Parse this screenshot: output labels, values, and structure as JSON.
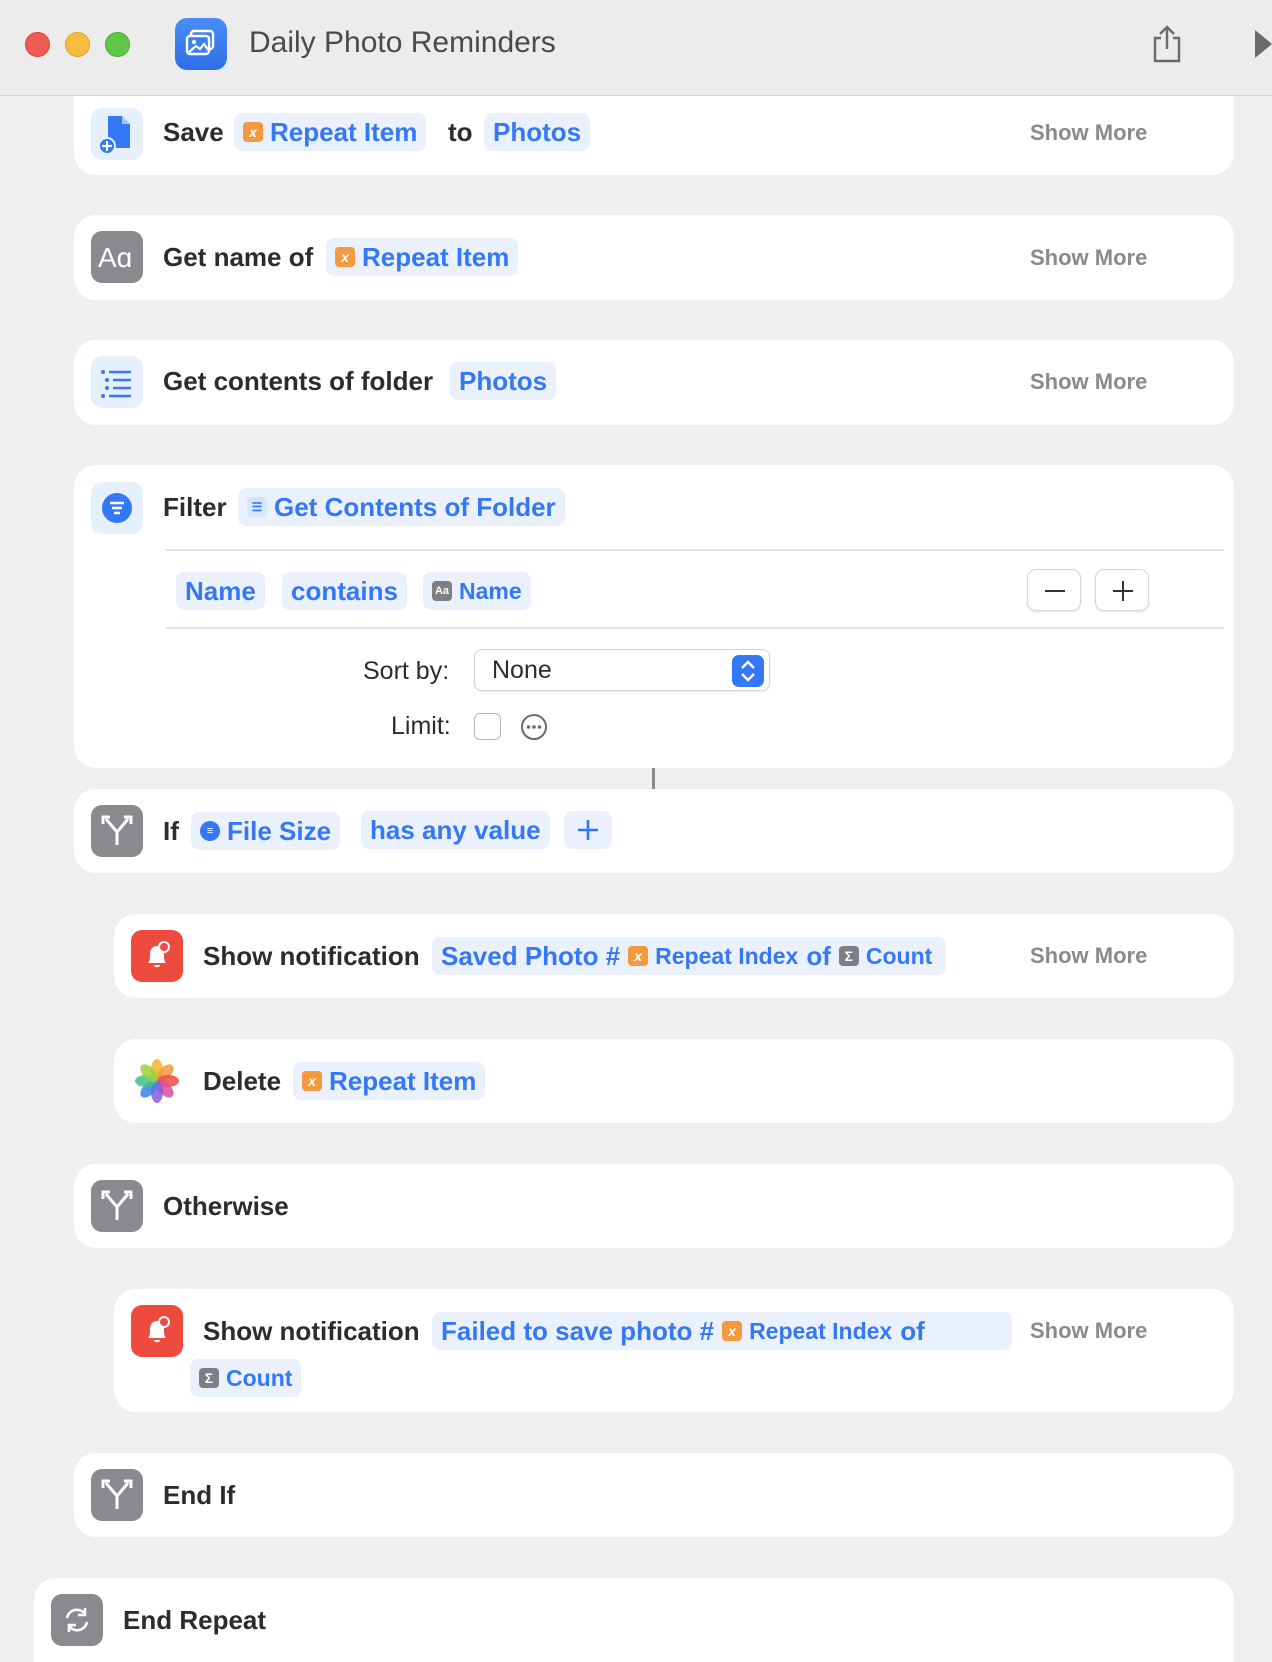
{
  "window": {
    "title": "Daily Photo Reminders"
  },
  "actions": {
    "save": {
      "verb": "Save",
      "item": "Repeat Item",
      "to": "to",
      "dest": "Photos",
      "show_more": "Show More"
    },
    "get_name": {
      "verb": "Get name of",
      "item": "Repeat Item",
      "show_more": "Show More"
    },
    "get_contents": {
      "verb": "Get contents of folder",
      "folder": "Photos",
      "show_more": "Show More"
    },
    "filter": {
      "verb": "Filter",
      "source": "Get Contents of Folder",
      "condition": {
        "field": "Name",
        "operator": "contains",
        "value": "Name"
      },
      "sort_label": "Sort by:",
      "sort_value": "None",
      "limit_label": "Limit:"
    },
    "if_block": {
      "verb": "If",
      "variable": "File Size",
      "condition": "has any value"
    },
    "notify_success": {
      "verb": "Show notification",
      "text": "Saved Photo #",
      "index": "Repeat Index",
      "of": "of",
      "count": "Count",
      "show_more": "Show More"
    },
    "delete": {
      "verb": "Delete",
      "item": "Repeat Item"
    },
    "otherwise": {
      "verb": "Otherwise"
    },
    "notify_fail": {
      "verb": "Show notification",
      "text": "Failed to save photo #",
      "index": "Repeat Index",
      "of": "of",
      "count": "Count",
      "show_more": "Show More"
    },
    "end_if": {
      "verb": "End If"
    },
    "end_repeat": {
      "verb": "End Repeat"
    }
  },
  "colors": {
    "accent": "#3478f6",
    "variable_orange": "#f29a3d",
    "notification_red": "#ee4b3f"
  }
}
